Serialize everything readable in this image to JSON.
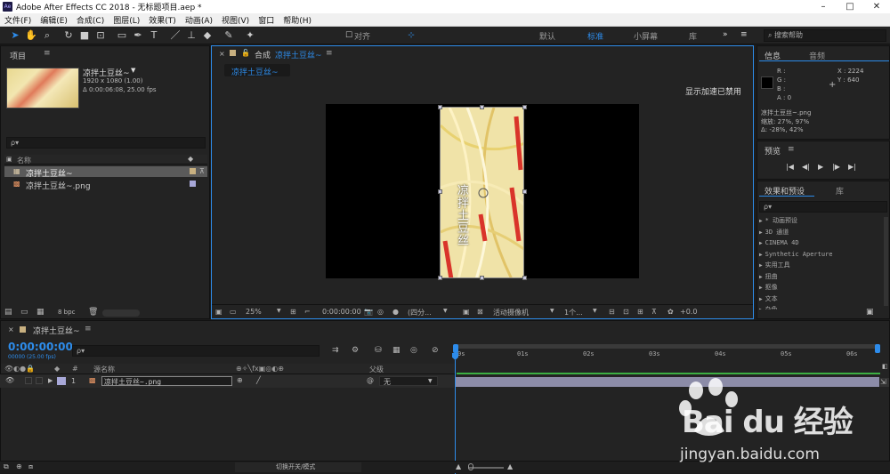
{
  "window": {
    "title": "Adobe After Effects CC 2018 - 无标题项目.aep *",
    "logo": "Ae"
  },
  "menu": [
    "文件(F)",
    "编辑(E)",
    "合成(C)",
    "图层(L)",
    "效果(T)",
    "动画(A)",
    "视图(V)",
    "窗口",
    "帮助(H)"
  ],
  "toolbar": {
    "snap_label": "对齐",
    "workspaces": [
      "默认",
      "标准",
      "小屏幕",
      "库"
    ],
    "active_workspace": "标准",
    "search_help": "搜索帮助"
  },
  "project": {
    "title": "项目",
    "item_name": "凉拌土豆丝~",
    "item_info1": "1920 x 1080 (1.00)",
    "item_info2": "Δ 0:00:06:08, 25.00 fps",
    "search_placeholder": "ρ▾",
    "col_name": "名称",
    "rows": [
      {
        "name": "凉拌土豆丝~",
        "type": "comp",
        "color": "#c8b080"
      },
      {
        "name": "凉拌土豆丝~.png",
        "type": "png",
        "color": "#a8a8d8"
      }
    ],
    "bpc": "8 bpc"
  },
  "comp": {
    "title_prefix": "合成",
    "title_name": "凉拌土豆丝~",
    "tab": "凉拌土豆丝~",
    "notice": "显示加速已禁用",
    "zoom": "25%",
    "timecode": "0:00:00:00",
    "resolution": "(四分...",
    "camera": "活动摄像机",
    "views": "1个...",
    "exposure": "+0.0",
    "overlay_text": "凉拌土豆丝"
  },
  "info": {
    "tab1": "信息",
    "tab2": "音频",
    "r": "R :",
    "g": "G :",
    "b": "B :",
    "a": "A : 0",
    "x": "X : 2224",
    "y": "Y : 640",
    "file": "凉拌土豆丝~.png",
    "scale": "缩放: 27%, 97%",
    "delta": "Δ: -28%, 42%"
  },
  "preview": {
    "title": "预览"
  },
  "effects": {
    "tab1": "效果和预设",
    "tab2": "库",
    "search_placeholder": "ρ▾",
    "items": [
      "* 动画预设",
      "3D 通道",
      "CINEMA 4D",
      "Synthetic Aperture",
      "实用工具",
      "扭曲",
      "抠像",
      "文本",
      "杂色"
    ]
  },
  "timeline": {
    "tab": "凉拌土豆丝~",
    "timecode": "0:00:00:00",
    "frames": "00000 (25.00 fps)",
    "search_placeholder": "ρ▾",
    "col_num": "#",
    "col_source": "源名称",
    "col_parent": "父级",
    "layer": {
      "num": "1",
      "name": "凉拌土豆丝~.png",
      "parent": "无"
    },
    "ruler": [
      "0s",
      "01s",
      "02s",
      "03s",
      "04s",
      "05s",
      "06s"
    ],
    "bottom_label": "切换开关/模式"
  },
  "watermark": {
    "brand": "Bai du 经验",
    "url": "jingyan.baidu.com"
  },
  "colors": {
    "accent": "#2d8ceb",
    "layer_bar": "#8c8ca8"
  }
}
